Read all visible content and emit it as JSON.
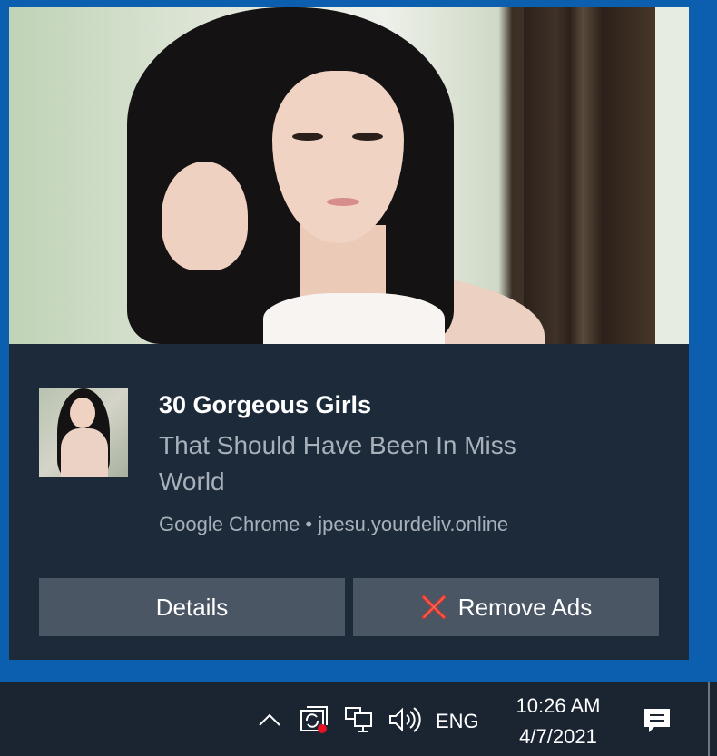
{
  "notification": {
    "title": "30 Gorgeous Girls",
    "message": "That Should Have Been In Miss World",
    "source": "Google Chrome • jpesu.yourdeliv.online",
    "buttons": {
      "details_label": "Details",
      "remove_ads_label": "Remove Ads"
    },
    "images": {
      "hero": "photo-of-woman",
      "thumbnail": "photo-of-woman-thumbnail"
    }
  },
  "taskbar": {
    "tray_icons": [
      "chevron-up-icon",
      "sync-icon",
      "network-icon",
      "volume-icon"
    ],
    "language": "ENG",
    "time": "10:26 AM",
    "date": "4/7/2021",
    "action_center_icon": "action-center-icon"
  },
  "colors": {
    "desktop_accent": "#0b5fae",
    "toast_background": "#1d2a3a",
    "button_background": "#4b5664",
    "taskbar_background": "#1b2532",
    "remove_icon_color": "#e8352a"
  }
}
